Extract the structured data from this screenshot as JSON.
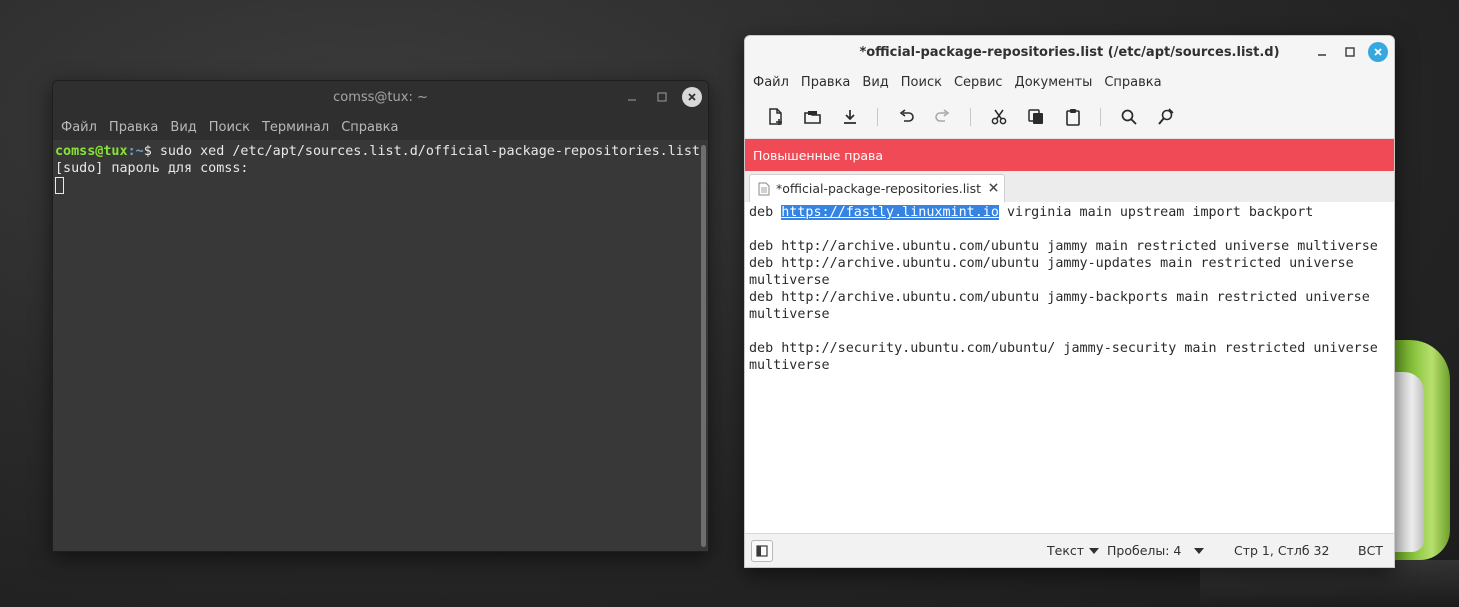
{
  "terminal": {
    "title": "comss@tux: ~",
    "menu": [
      "Файл",
      "Правка",
      "Вид",
      "Поиск",
      "Терминал",
      "Справка"
    ],
    "prompt_user": "comss@tux",
    "prompt_path": ":~",
    "prompt_symbol": "$ ",
    "command": "sudo xed /etc/apt/sources.list.d/official-package-repositories.list",
    "sudo_prompt": "[sudo] пароль для comss:"
  },
  "editor": {
    "title": "*official-package-repositories.list (/etc/apt/sources.list.d)",
    "menu": [
      "Файл",
      "Правка",
      "Вид",
      "Поиск",
      "Сервис",
      "Документы",
      "Справка"
    ],
    "infobar": "Повышенные права",
    "tab_label": "*official-package-repositories.list",
    "lines": {
      "l1_prefix": "deb ",
      "l1_selected": "https://fastly.linuxmint.io",
      "l1_suffix": " virginia main upstream import backport",
      "l2": "",
      "l3": "deb http://archive.ubuntu.com/ubuntu jammy main restricted universe multiverse",
      "l4": "deb http://archive.ubuntu.com/ubuntu jammy-updates main restricted universe",
      "l5": "multiverse",
      "l6": "deb http://archive.ubuntu.com/ubuntu jammy-backports main restricted universe",
      "l7": "multiverse",
      "l8": "",
      "l9": "deb http://security.ubuntu.com/ubuntu/ jammy-security main restricted universe",
      "l10": "multiverse"
    },
    "status": {
      "language": "Текст",
      "spaces": "Пробелы: 4",
      "position": "Стр 1, Стлб 32",
      "mode": "ВСТ"
    }
  },
  "colors": {
    "infobar": "#ef4a55",
    "selection": "#3584e4",
    "close_button": "#35a8e0",
    "prompt_user": "#8ae234",
    "prompt_path": "#729fcf"
  }
}
